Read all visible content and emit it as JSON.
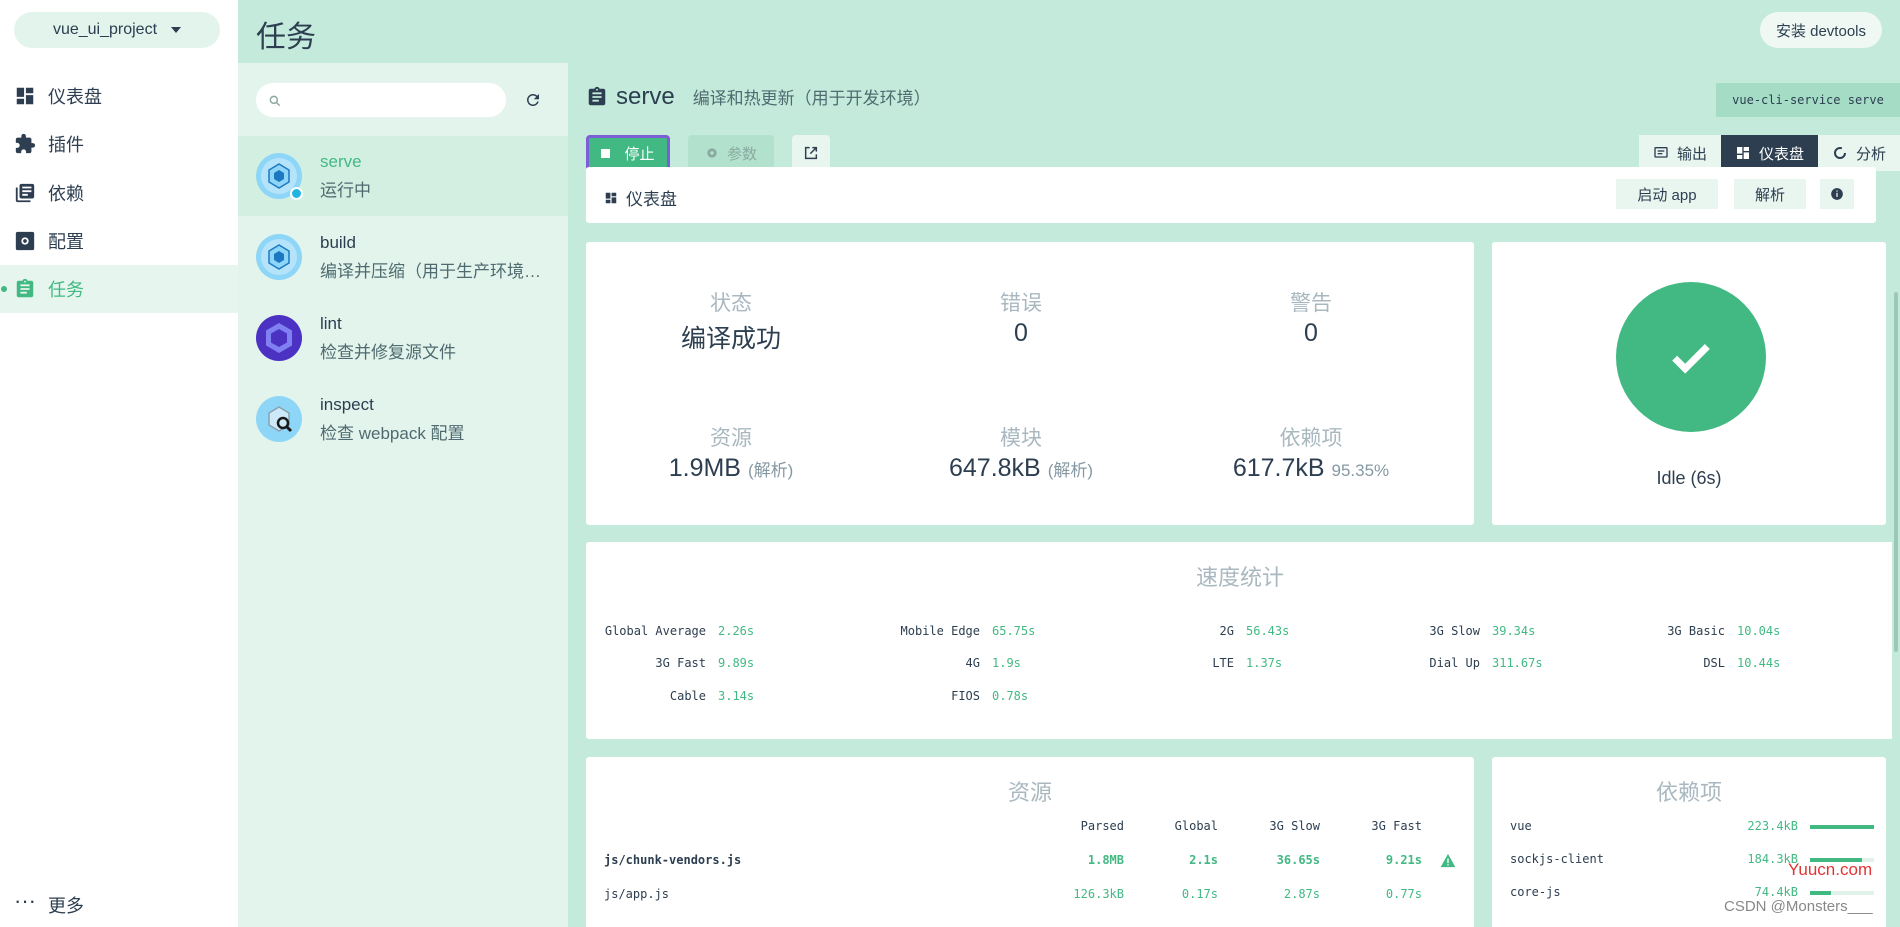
{
  "project": {
    "name": "vue_ui_project"
  },
  "nav": {
    "items": [
      {
        "label": "仪表盘",
        "icon": "dashboard-icon"
      },
      {
        "label": "插件",
        "icon": "puzzle-icon"
      },
      {
        "label": "依赖",
        "icon": "library-icon"
      },
      {
        "label": "配置",
        "icon": "settings-icon"
      },
      {
        "label": "任务",
        "icon": "clipboard-icon",
        "active": true
      }
    ],
    "more": "更多"
  },
  "topbar": {
    "title": "任务",
    "devtools_label": "安装 devtools"
  },
  "tasks": {
    "search_placeholder": "",
    "items": [
      {
        "name": "serve",
        "desc": "运行中",
        "icon": "webpack-icon",
        "active": true
      },
      {
        "name": "build",
        "desc": "编译并压缩（用于生产环境…",
        "icon": "webpack-icon"
      },
      {
        "name": "lint",
        "desc": "检查并修复源文件",
        "icon": "eslint-icon"
      },
      {
        "name": "inspect",
        "desc": "检查 webpack 配置",
        "icon": "inspect-icon"
      }
    ]
  },
  "main": {
    "task_name": "serve",
    "task_desc": "编译和热更新（用于开发环境）",
    "command": "vue-cli-service serve",
    "stop_label": "停止",
    "params_label": "参数",
    "tabs": [
      {
        "label": "输出"
      },
      {
        "label": "仪表盘",
        "active": true
      },
      {
        "label": "分析"
      }
    ],
    "strip": {
      "label": "仪表盘",
      "open_app": "启动 app",
      "parse": "解析"
    }
  },
  "stats": {
    "status": {
      "label": "状态",
      "value": "编译成功"
    },
    "errors": {
      "label": "错误",
      "value": "0"
    },
    "warnings": {
      "label": "警告",
      "value": "0"
    },
    "assets": {
      "label": "资源",
      "value": "1.9MB",
      "note": "(解析)"
    },
    "modules": {
      "label": "模块",
      "value": "647.8kB",
      "note": "(解析)"
    },
    "deps": {
      "label": "依赖项",
      "value": "617.7kB",
      "note": "95.35%"
    }
  },
  "status_card": {
    "text": "Idle (6s)"
  },
  "speed": {
    "title": "速度统计",
    "rows": [
      [
        {
          "k": "Global Average",
          "v": "2.26s"
        },
        {
          "k": "Mobile Edge",
          "v": "65.75s"
        },
        {
          "k": "2G",
          "v": "56.43s"
        },
        {
          "k": "3G Slow",
          "v": "39.34s"
        },
        {
          "k": "3G Basic",
          "v": "10.04s"
        }
      ],
      [
        {
          "k": "3G Fast",
          "v": "9.89s"
        },
        {
          "k": "4G",
          "v": "1.9s"
        },
        {
          "k": "LTE",
          "v": "1.37s"
        },
        {
          "k": "Dial Up",
          "v": "311.67s"
        },
        {
          "k": "DSL",
          "v": "10.44s"
        }
      ],
      [
        {
          "k": "Cable",
          "v": "3.14s"
        },
        {
          "k": "FIOS",
          "v": "0.78s"
        }
      ]
    ]
  },
  "assets": {
    "title": "资源",
    "headers": [
      "Parsed",
      "Global",
      "3G Slow",
      "3G Fast"
    ],
    "rows": [
      {
        "name": "js/chunk-vendors.js",
        "parsed": "1.8MB",
        "global": "2.1s",
        "slow": "36.65s",
        "fast": "9.21s",
        "bold": true
      },
      {
        "name": "js/app.js",
        "parsed": "126.3kB",
        "global": "0.17s",
        "slow": "2.87s",
        "fast": "0.77s"
      }
    ]
  },
  "deps_card": {
    "title": "依赖项",
    "items": [
      {
        "name": "vue",
        "size": "223.4kB",
        "ratio": 1.0
      },
      {
        "name": "sockjs-client",
        "size": "184.3kB",
        "ratio": 0.82
      },
      {
        "name": "core-js",
        "size": "74.4kB",
        "ratio": 0.33
      }
    ]
  },
  "watermarks": {
    "site": "Yuucn.com",
    "csdn": "CSDN @Monsters___"
  },
  "colors": {
    "accent": "#42b983",
    "dark": "#2c3e50",
    "bg": "#c4eadb"
  }
}
